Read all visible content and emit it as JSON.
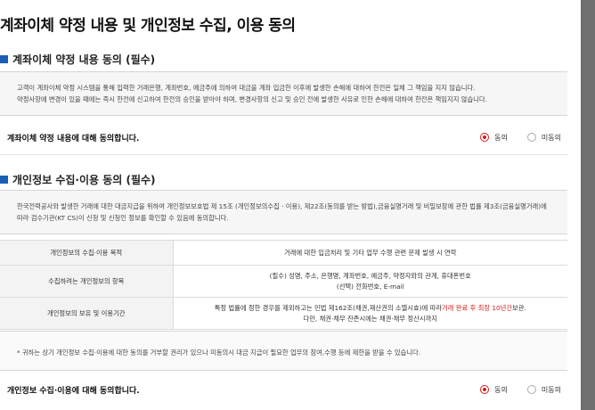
{
  "page": {
    "title": "계좌이체 약정 내용 및 개인정보 수집, 이용 동의"
  },
  "section1": {
    "title": "계좌이체 약정 내용 동의 (필수)",
    "lines": [
      "고객이 계좌이체 약정 시스템을 통해 입력한 거래은행, 계좌번호, 예금주에 의하여 대금을 계좌 입금한 이후에 발생한 손해에 대하여 한전은 일체 그 책임을 지지 않습니다.",
      "약정사항에 변경이 있을 때에는 즉시 한전에 신고하여 한전의 승인을 받아야 하며, 변경사항의 신고 및 승인 전에 발생한 사유로 인한 손해에 대하여 한전은 책임지지 않습니다."
    ],
    "agree_label": "계좌이체 약정 내용에 대해 동의합니다.",
    "radio_agree": "동의",
    "radio_disagree": "미동의"
  },
  "section2": {
    "title": "개인정보 수집·이용 동의 (필수)",
    "lines": [
      "한국전력공사와 발생한 거래에 대한 대금지급을 위하여 개인정보보호법 제 15조 (개인정보의수집 · 이용), 제22조(동의를 받는 방법),금융실명거래 및 비밀보장에 관한 법률 제3조(금융실명거래)에",
      "따라 검수기관(KT CS)이 신청 및 신청인 정보를 확인할 수 있음에 동의합니다."
    ],
    "table": {
      "row1": {
        "header": "개인정보의 수집·이용 목적",
        "value": "거래에 대한 입금처리 및 기타 업무 수행 관련 문제 발생 시 연락"
      },
      "row2": {
        "header": "수집하려는 개인정보의 항목",
        "value_line1": "(필수) 성명, 주소, 은행명, 계좌번호, 예금주, 약정자와의 관계, 휴대폰번호",
        "value_line2": "(선택) 전화번호, E-mail"
      },
      "row3": {
        "header": "개인정보의 보유 및 이용기간",
        "value_line1_a": "특정 법률에 정한 경우를 제외하고는 민법 제162조(채권,재산권의 소멸시효)에 따라",
        "value_line1_b": "거래 완료 후 최장 10년간",
        "value_line1_c": "보관.",
        "value_line2": "다만, 채권·채무 잔존시에는 채권·채무 정산시까지"
      }
    },
    "note": "* 귀하는 상기 개인정보 수집·이용에 대한 동의를 거부할 권리가 있으나 미동의시 대금 지급이 필요한 업무의 참여,수행 등에 제한을 받을 수 있습니다.",
    "agree_label": "개인정보 수집·이용에 대해 동의합니다.",
    "radio_agree": "동의",
    "radio_disagree": "미동의"
  },
  "colors": {
    "accent_red": "#d41c1c",
    "bullet_blue": "#1a5fb4",
    "backdrop": "#6f6f6f"
  }
}
